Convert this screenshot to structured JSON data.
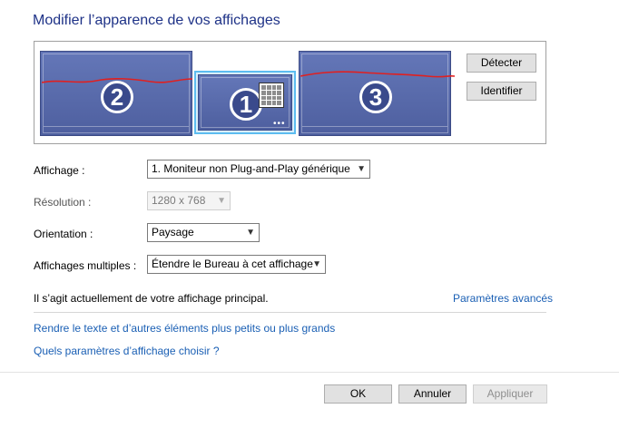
{
  "page": {
    "title": "Modifier l’apparence de vos affichages"
  },
  "arrangement": {
    "monitors": [
      {
        "number": "2"
      },
      {
        "number": "1"
      },
      {
        "number": "3"
      }
    ],
    "selected_dots": "•••",
    "detect_label": "Détecter",
    "identify_label": "Identifier",
    "annotation_color": "#e02020",
    "selected_border_color": "#5dbdf0"
  },
  "settings": {
    "display": {
      "label": "Affichage :",
      "value": "1. Moniteur non Plug-and-Play générique"
    },
    "resolution": {
      "label": "Résolution :",
      "value": "1280 x 768"
    },
    "orientation": {
      "label": "Orientation :",
      "value": "Paysage"
    },
    "multiple": {
      "label": "Affichages multiples :",
      "value": "Étendre le Bureau à cet affichage"
    }
  },
  "status": {
    "primary_text": "Il s’agit actuellement de votre affichage principal.",
    "advanced_link": "Paramètres avancés"
  },
  "links": {
    "text_size": "Rendre le texte et d’autres éléments plus petits ou plus grands",
    "which_settings": "Quels paramètres d’affichage choisir ?"
  },
  "footer": {
    "ok_label": "OK",
    "cancel_label": "Annuler",
    "apply_label": "Appliquer"
  },
  "colors": {
    "title": "#1e3287",
    "link": "#1a5fb4",
    "monitor_fill": "#5668a9"
  }
}
